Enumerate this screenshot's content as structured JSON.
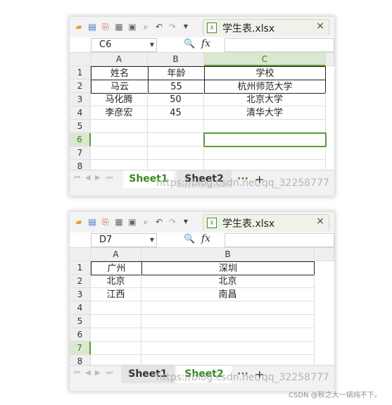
{
  "window1": {
    "file_name": "学生表.xlsx",
    "close_symbol": "×",
    "cell_ref": "C6",
    "fx_label": "fx",
    "columns": [
      "A",
      "B",
      "C"
    ],
    "rows": [
      "1",
      "2",
      "3",
      "4",
      "5",
      "6",
      "7",
      "8"
    ],
    "cells": [
      [
        "姓名",
        "年龄",
        "学校"
      ],
      [
        "马云",
        "55",
        "杭州师范大学"
      ],
      [
        "马化腾",
        "50",
        "北京大学"
      ],
      [
        "李彦宏",
        "45",
        "清华大学"
      ]
    ],
    "sheets": [
      "Sheet1",
      "Sheet2"
    ],
    "active_sheet": "Sheet1",
    "more_label": "···",
    "add_label": "+"
  },
  "window2": {
    "file_name": "学生表.xlsx",
    "close_symbol": "×",
    "cell_ref": "D7",
    "fx_label": "fx",
    "columns": [
      "A",
      "B"
    ],
    "rows": [
      "1",
      "2",
      "3",
      "4",
      "5",
      "6",
      "7",
      "8"
    ],
    "cells": [
      [
        "广州",
        "深圳"
      ],
      [
        "北京",
        "北京"
      ],
      [
        "江西",
        "南昌"
      ]
    ],
    "sheets": [
      "Sheet1",
      "Sheet2"
    ],
    "active_sheet": "Sheet2",
    "more_label": "···",
    "add_label": "+"
  },
  "watermark": "https://blog.csdn.net/qq_32258777",
  "credit": "CSDN @秋之大一锅炖不下。",
  "colors": {
    "accent_green": "#3a8a1f",
    "selection_green": "#5a9b3a"
  }
}
